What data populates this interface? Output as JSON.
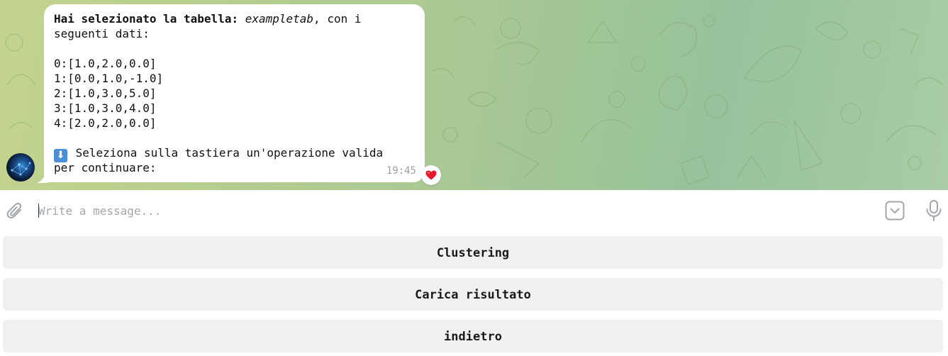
{
  "message": {
    "prefix_bold": "Hai selezionato la tabella: ",
    "table_name_italic": "exampletab",
    "suffix_line1": ", con i",
    "line2": "seguenti dati:",
    "rows": [
      "0:[1.0,2.0,0.0]",
      "1:[0.0,1.0,-1.0]",
      "2:[1.0,3.0,5.0]",
      "3:[1.0,3.0,4.0]",
      "4:[2.0,2.0,0.0]"
    ],
    "emoji": "⬇",
    "instruction_line1": " Seleziona sulla tastiera un'operazione valida",
    "instruction_line2": "per continuare:",
    "time": "19:45",
    "reaction_icon": "heart-icon",
    "reaction_color": "#e8192c"
  },
  "composer": {
    "placeholder": "Write a message...",
    "value": "",
    "attach_icon": "paperclip-icon",
    "keyboard_icon": "keyboard-toggle-icon",
    "mic_icon": "microphone-icon"
  },
  "keyboard": {
    "buttons": [
      "Clustering",
      "Carica risultato",
      "indietro"
    ]
  },
  "colors": {
    "chat_bg_start": "#c4d48f",
    "chat_bg_end": "#a9cca4",
    "bubble": "#ffffff",
    "button_bg": "#f0f0f0",
    "accent_blue": "#4a8fd8"
  }
}
